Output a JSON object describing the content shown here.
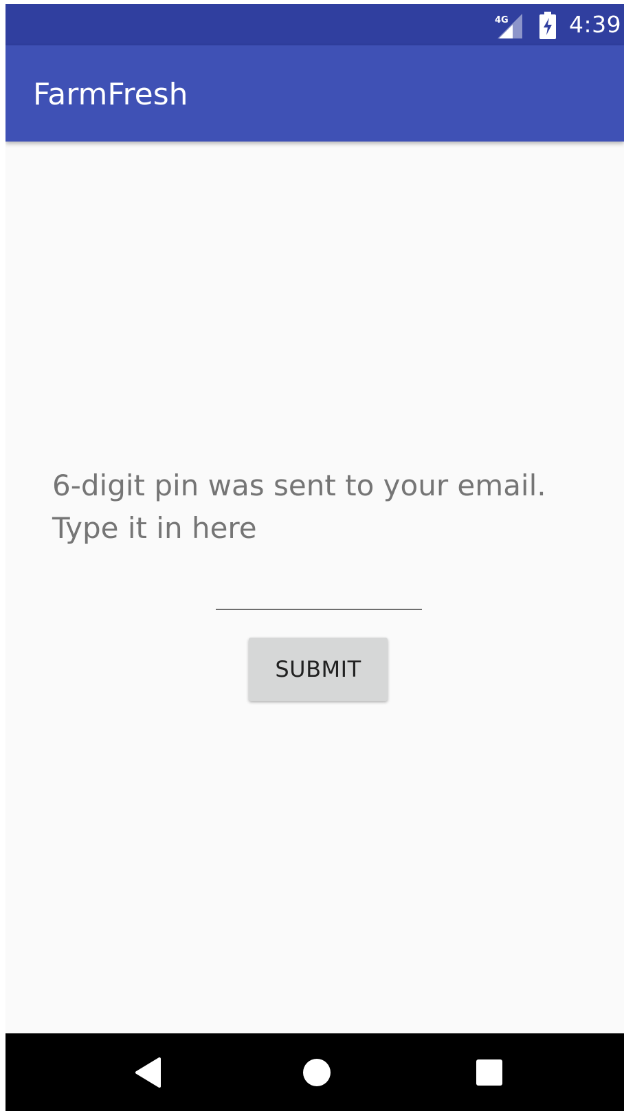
{
  "status_bar": {
    "network_label": "4G",
    "battery_icon": "battery-charging-icon",
    "time": "4:39"
  },
  "app_bar": {
    "title": "FarmFresh"
  },
  "content": {
    "instruction_line1": "6-digit pin was sent to your email.",
    "instruction_line2": "Type it in here",
    "pin_value": "",
    "submit_label": "SUBMIT"
  },
  "nav_bar": {
    "back_icon": "back-triangle-icon",
    "home_icon": "home-circle-icon",
    "recents_icon": "recents-square-icon"
  },
  "colors": {
    "status_bar": "#303f9f",
    "app_bar": "#3f51b5",
    "background": "#fafafa",
    "instruction_text": "#757575",
    "button_fill": "#d6d7d7",
    "nav_bar": "#000000"
  }
}
